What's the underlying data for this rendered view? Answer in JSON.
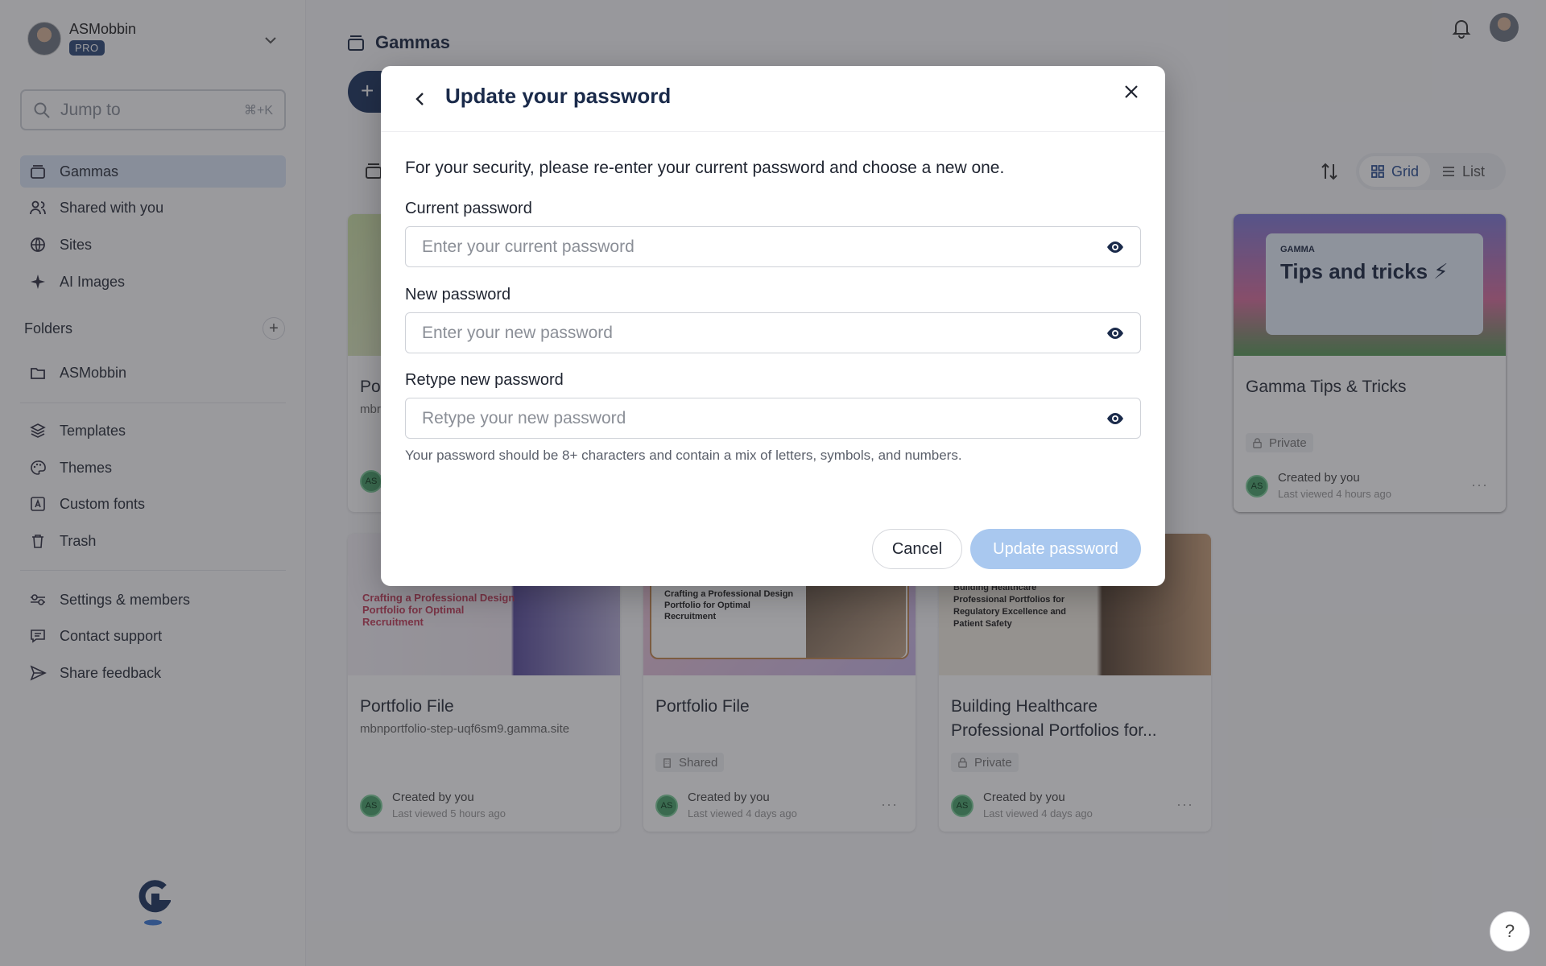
{
  "account": {
    "name": "ASMobbin",
    "plan": "PRO"
  },
  "search": {
    "label": "Jump to",
    "shortcut": "⌘+K"
  },
  "sidebar": {
    "nav": [
      {
        "label": "Gammas",
        "icon": "stack-icon",
        "active": true
      },
      {
        "label": "Shared with you",
        "icon": "users-icon"
      },
      {
        "label": "Sites",
        "icon": "globe-icon"
      },
      {
        "label": "AI Images",
        "icon": "sparkle-icon"
      }
    ],
    "folders_heading": "Folders",
    "folders": [
      {
        "label": "ASMobbin",
        "icon": "folder-icon"
      }
    ],
    "tools": [
      {
        "label": "Templates",
        "icon": "layers-icon"
      },
      {
        "label": "Themes",
        "icon": "palette-icon"
      },
      {
        "label": "Custom fonts",
        "icon": "font-icon"
      },
      {
        "label": "Trash",
        "icon": "trash-icon"
      }
    ],
    "footer": [
      {
        "label": "Settings & members",
        "icon": "settings-icon"
      },
      {
        "label": "Contact support",
        "icon": "chat-icon"
      },
      {
        "label": "Share feedback",
        "icon": "send-icon"
      }
    ]
  },
  "header": {
    "title": "Gammas"
  },
  "view": {
    "grid_label": "Grid",
    "list_label": "List",
    "selected": "Grid"
  },
  "cards": [
    {
      "title": "Po",
      "subtitle": "mbr",
      "badge": "",
      "created": "",
      "viewed": "",
      "avatar": "AS"
    },
    {
      "title": "Gamma Tips & Tricks",
      "subtitle": "",
      "badge": "Private",
      "created": "Created by you",
      "viewed": "Last viewed 4 hours ago",
      "avatar": "AS",
      "thumb_brand": "GAMMA",
      "thumb_title": "Tips and tricks ⚡"
    },
    {
      "title": "Portfolio File",
      "subtitle": "mbnportfolio-step-uqf6sm9.gamma.site",
      "badge": "",
      "created": "Created by you",
      "viewed": "Last viewed 5 hours ago",
      "avatar": "AS",
      "thumb_text": "Crafting a Professional Design Portfolio for Optimal Recruitment"
    },
    {
      "title": "Portfolio File",
      "subtitle": "",
      "badge": "Shared",
      "created": "Created by you",
      "viewed": "Last viewed 4 days ago",
      "avatar": "AS",
      "thumb_text": "Crafting a Professional Design Portfolio for Optimal Recruitment"
    },
    {
      "title": "Building Healthcare Professional Portfolios for...",
      "subtitle": "",
      "badge": "Private",
      "created": "Created by you",
      "viewed": "Last viewed 4 days ago",
      "avatar": "AS",
      "thumb_text": "Building Healthcare Professional Portfolios for Regulatory Excellence and Patient Safety"
    }
  ],
  "modal": {
    "title": "Update your password",
    "intro": "For your security, please re-enter your current password and choose a new one.",
    "fields": [
      {
        "label": "Current password",
        "placeholder": "Enter your current password"
      },
      {
        "label": "New password",
        "placeholder": "Enter your new password"
      },
      {
        "label": "Retype new password",
        "placeholder": "Retype your new password"
      }
    ],
    "hint": "Your password should be 8+ characters and contain a mix of letters, symbols, and numbers.",
    "cancel_label": "Cancel",
    "submit_label": "Update password"
  },
  "help_label": "?",
  "colors": {
    "accent": "#1f3760",
    "active_nav": "#dbe6f6",
    "submit_disabled": "#a9c8ef"
  }
}
